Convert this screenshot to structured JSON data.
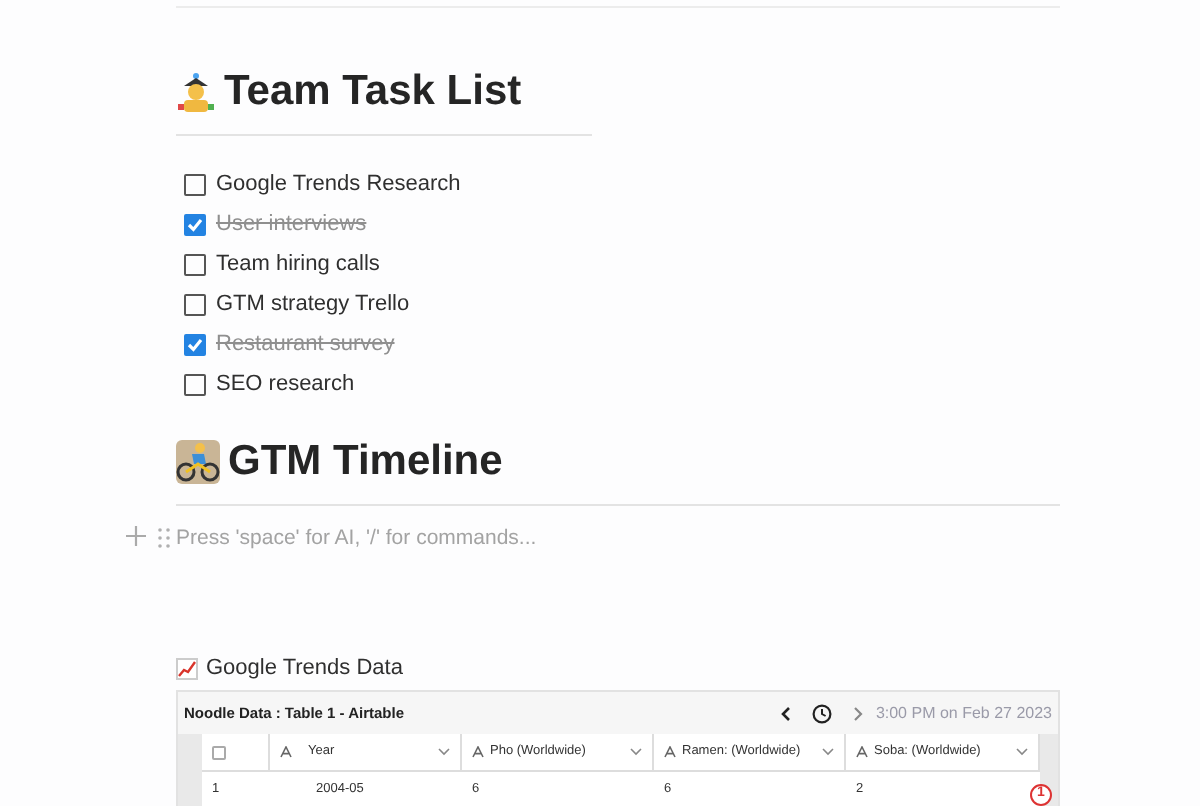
{
  "sections": [
    {
      "title": "Team Task List",
      "tasks": [
        {
          "label": "Google Trends Research",
          "checked": false
        },
        {
          "label": "User interviews",
          "checked": true
        },
        {
          "label": "Team hiring calls",
          "checked": false
        },
        {
          "label": "GTM strategy Trello",
          "checked": false
        },
        {
          "label": "Restaurant survey",
          "checked": true
        },
        {
          "label": "SEO research",
          "checked": false
        }
      ]
    },
    {
      "title": "GTM Timeline"
    }
  ],
  "editor": {
    "placeholder": "Press 'space' for AI, '/' for commands..."
  },
  "embed": {
    "caption": "Google Trends Data",
    "title": "Noodle Data : Table 1 - Airtable",
    "timestamp": "3:00 PM on Feb 27 2023",
    "select_all": {
      "checked": false
    },
    "columns": [
      "Year",
      "Pho (Worldwide)",
      "Ramen: (Worldwide)",
      "Soba: (Worldwide)"
    ],
    "rows": [
      {
        "number": "1",
        "cells": [
          "2004-05",
          "6",
          "6",
          "2"
        ]
      }
    ],
    "badge": "1"
  }
}
